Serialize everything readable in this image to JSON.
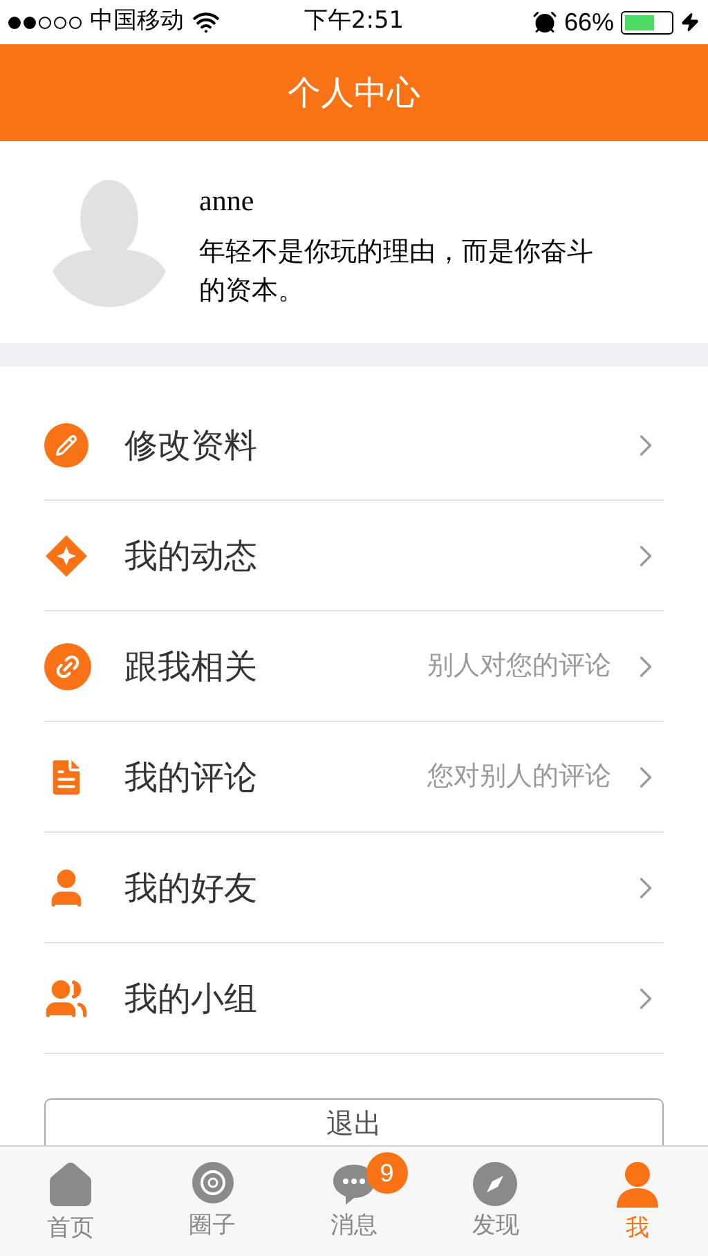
{
  "status_bar": {
    "carrier": "中国移动",
    "time": "下午2:51",
    "battery": "66%"
  },
  "header": {
    "title": "个人中心"
  },
  "profile": {
    "name": "anne",
    "motto": "年轻不是你玩的理由，而是你奋斗的资本。"
  },
  "menu": [
    {
      "kind": "edit",
      "label": "修改资料"
    },
    {
      "kind": "diamond",
      "label": "我的动态"
    },
    {
      "kind": "link",
      "label": "跟我相关",
      "hint": "别人对您的评论"
    },
    {
      "kind": "document",
      "label": "我的评论",
      "hint": "您对别人的评论"
    },
    {
      "kind": "person",
      "label": "我的好友"
    },
    {
      "kind": "group",
      "label": "我的小组"
    }
  ],
  "logout": "退出",
  "tabs": [
    {
      "kind": "home",
      "label": "首页",
      "selected": false
    },
    {
      "kind": "circle",
      "label": "圈子",
      "selected": false
    },
    {
      "kind": "message",
      "label": "消息",
      "selected": false,
      "badge": "9"
    },
    {
      "kind": "compass",
      "label": "发现",
      "selected": false
    },
    {
      "kind": "me",
      "label": "我",
      "selected": true
    }
  ]
}
